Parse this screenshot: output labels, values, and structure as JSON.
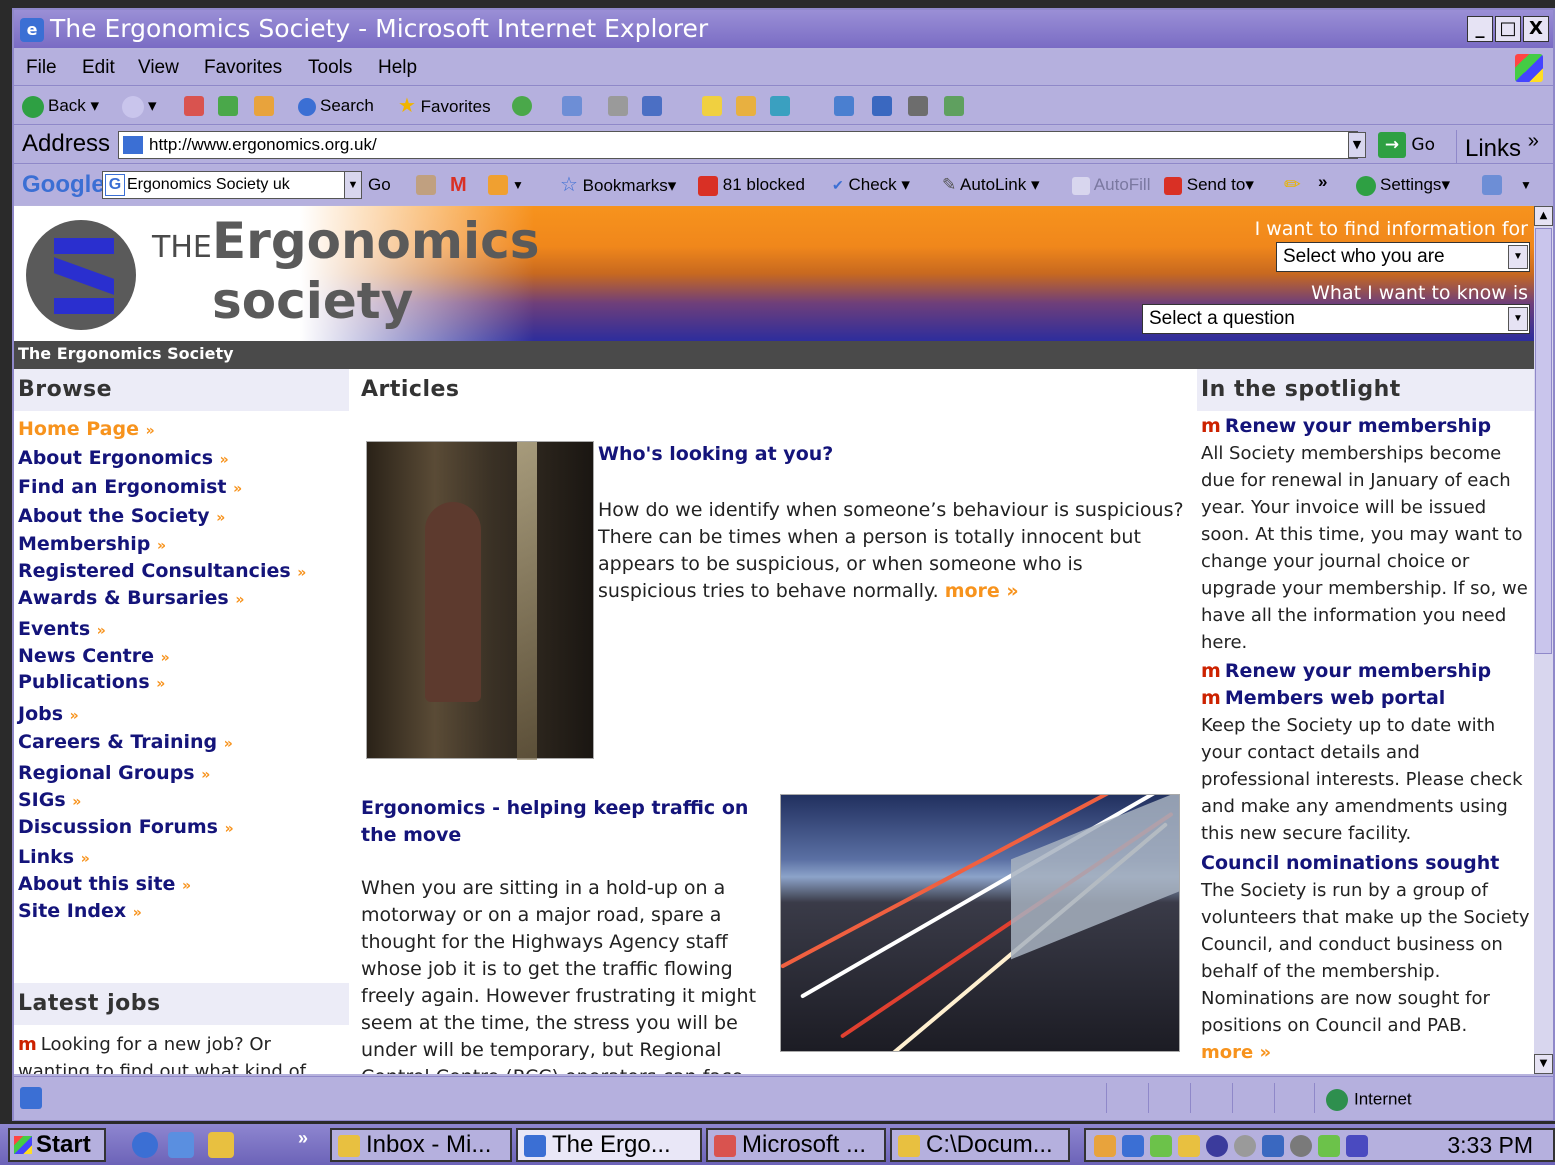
{
  "window": {
    "title": "The Ergonomics Society - Microsoft Internet Explorer",
    "controls": [
      "_",
      "□",
      "X"
    ]
  },
  "menu": [
    "File",
    "Edit",
    "View",
    "Favorites",
    "Tools",
    "Help"
  ],
  "toolbar": {
    "back": "Back",
    "search": "Search",
    "favorites": "Favorites"
  },
  "address": {
    "label": "Address",
    "url": "http://www.ergonomics.org.uk/",
    "go": "Go",
    "links": "Links"
  },
  "googlebar": {
    "logo": "Google",
    "query": "Ergonomics Society uk",
    "go": "Go",
    "bookmarks": "Bookmarks",
    "blocked": "81 blocked",
    "check": "Check",
    "autolink": "AutoLink",
    "autofill": "AutoFill",
    "sendto": "Send to",
    "settings": "Settings"
  },
  "site": {
    "logo_the": "THE",
    "logo_ergonomics": "Ergonomics",
    "logo_society": "society",
    "find_label": "I want to find information for",
    "who_select": "Select who you are",
    "know_label": "What I want to know is",
    "question_select": "Select a question",
    "breadcrumb": "The Ergonomics Society"
  },
  "browse": {
    "heading": "Browse",
    "items": [
      "Home Page",
      "About Ergonomics",
      "Find an Ergonomist",
      "About the Society",
      "Membership",
      "Registered Consultancies",
      "Awards & Bursaries",
      "Events",
      "News Centre",
      "Publications",
      "Jobs",
      "Careers & Training",
      "Regional Groups",
      "SIGs",
      "Discussion Forums",
      "Links",
      "About this site",
      "Site Index"
    ],
    "arrow": "»"
  },
  "latest_jobs": {
    "heading": "Latest jobs",
    "text": "Looking for a new job? Or wanting to find out what kind of"
  },
  "articles": {
    "heading": "Articles",
    "a1_title": "Who's looking at you?",
    "a1_text": "How do we identify when someone’s behaviour is suspicious? There can be times when a person is totally innocent but appears to be suspicious, or when someone who is suspicious tries to behave normally.",
    "a2_title": "Ergonomics - helping keep traffic on the move",
    "a2_text": "When you are sitting in a hold-up on a motorway or on a major road, spare a thought for the Highways Agency staff whose job it is to get the traffic flowing freely again. However frustrating it might seem at the time, the stress you will be under will be temporary, but Regional Control Centre (RCC) operators can face considerable pressures throughout their working day.",
    "more": "more »"
  },
  "spotlight": {
    "heading": "In the spotlight",
    "renew1": "Renew your membership",
    "renew_text": "All Society memberships become due for renewal in January of each year. Your invoice will be issued soon. At this time, you may want to change your journal choice or upgrade your membership. If so, we have all the information you need here.",
    "renew2": "Renew your membership",
    "portal": "Members web portal",
    "portal_text": "Keep the Society up to date with your contact details and professional interests. Please check and make any amendments using this new secure facility.",
    "council": "Council nominations sought",
    "council_text": "The Society is run by a group of volunteers that make up the Society Council, and conduct business on behalf of the membership. Nominations are now sought for positions on Council and PAB.",
    "more": "more »",
    "m": "m"
  },
  "status": {
    "zone": "Internet"
  },
  "taskbar": {
    "start": "Start",
    "tasks": [
      "Inbox - Mi...",
      "The Ergo...",
      "Microsoft ...",
      "C:\\Docum..."
    ],
    "clock": "3:33 PM"
  }
}
